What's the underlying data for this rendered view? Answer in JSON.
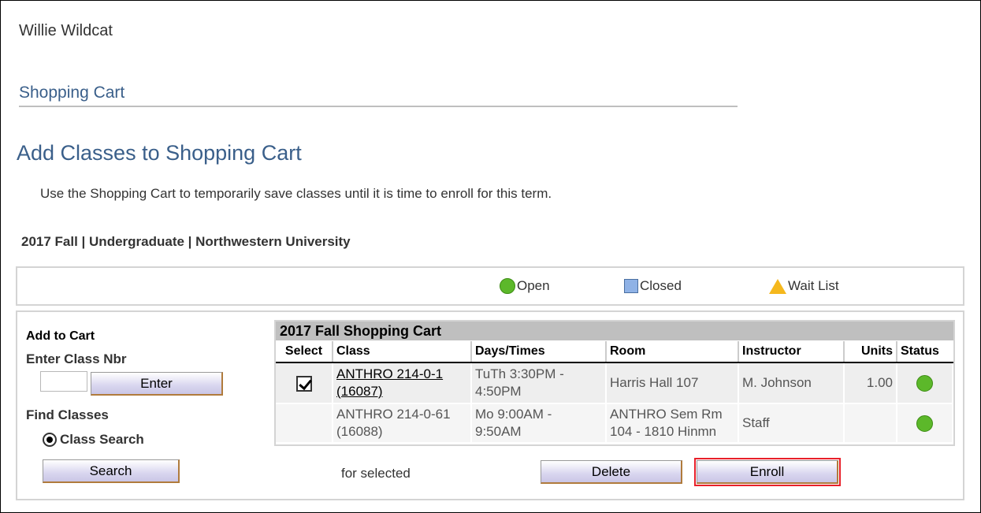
{
  "user": {
    "name": "Willie Wildcat"
  },
  "breadcrumb": {
    "title": "Shopping Cart"
  },
  "page": {
    "title": "Add Classes to Shopping Cart",
    "instructions": "Use the Shopping Cart to temporarily save classes until it is time to enroll for this term.",
    "term": "2017 Fall | Undergraduate | Northwestern University"
  },
  "legend": {
    "open": "Open",
    "closed": "Closed",
    "wait_list": "Wait List"
  },
  "add_panel": {
    "add_to_cart": "Add to Cart",
    "enter_class_nbr": "Enter Class Nbr",
    "class_nbr_value": "",
    "enter_button": "Enter",
    "find_classes": "Find Classes",
    "class_search_option": "Class Search",
    "search_button": "Search"
  },
  "cart": {
    "title": "2017 Fall Shopping Cart",
    "columns": [
      "Select",
      "Class",
      "Days/Times",
      "Room",
      "Instructor",
      "Units",
      "Status"
    ],
    "rows": [
      {
        "selected": true,
        "class_line1": "ANTHRO 214-0-1",
        "class_line2": "(16087)",
        "days_line1": "TuTh 3:30PM -",
        "days_line2": "4:50PM",
        "room_line1": "Harris Hall 107",
        "room_line2": "",
        "instructor": "M. Johnson",
        "units": "1.00",
        "status": "open"
      },
      {
        "selected": false,
        "class_line1": "ANTHRO 214-0-61",
        "class_line2": "(16088)",
        "days_line1": "Mo 9:00AM -",
        "days_line2": "9:50AM",
        "room_line1": "ANTHRO Sem Rm",
        "room_line2": "104 - 1810 Hinmn",
        "instructor": "Staff",
        "units": "",
        "status": "open"
      }
    ]
  },
  "actions": {
    "for_selected": "for selected",
    "delete_button": "Delete",
    "enroll_button": "Enroll"
  },
  "colors": {
    "title_blue": "#3a5f8a",
    "open_green": "#5cb82a",
    "closed_blue": "#8fb2e6",
    "wait_yellow": "#f5b81d",
    "highlight_red": "#e8202a"
  }
}
